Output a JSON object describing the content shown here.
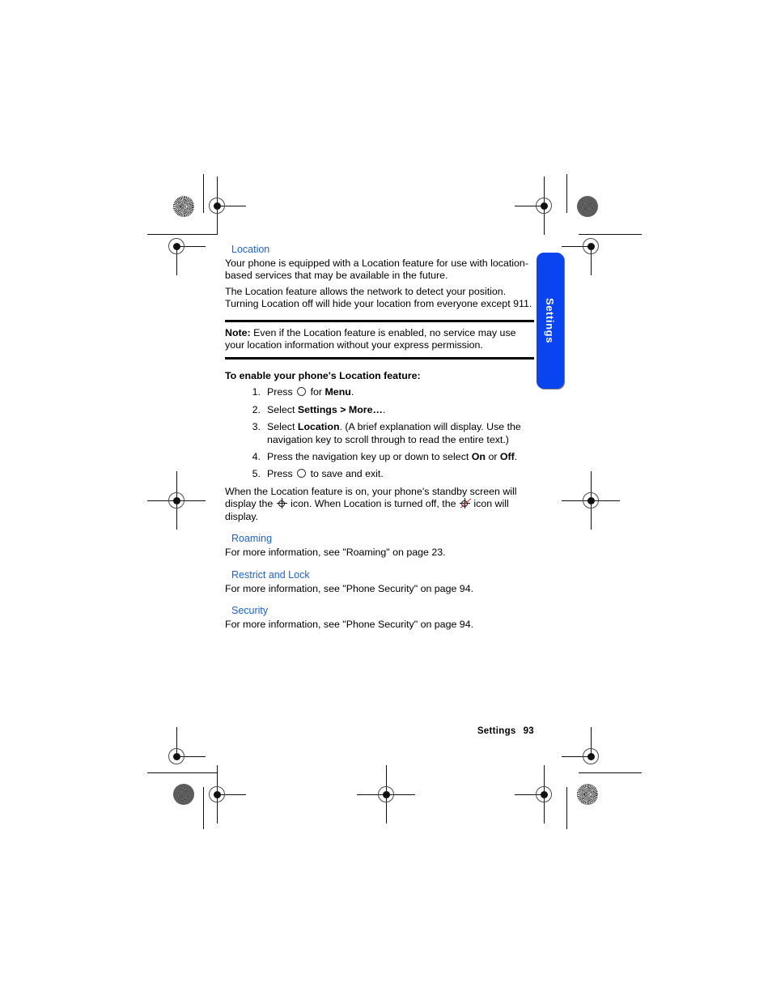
{
  "document": {
    "side_tab_label": "Settings",
    "footer": {
      "section": "Settings",
      "page_number": "93"
    }
  },
  "sections": [
    {
      "id": "location",
      "heading": "Location",
      "paragraphs": [
        "Your phone is equipped with a Location feature for use with location-based services that may be available in the future.",
        "The Location feature allows the network to detect your position. Turning Location off will hide your location from everyone except 911."
      ]
    }
  ],
  "note": {
    "label": "Note:",
    "text": " Even if the Location feature is enabled, no service may use your location information without your express permission."
  },
  "procedure": {
    "heading": "To enable your phone's Location feature:",
    "steps": [
      {
        "number": "1.",
        "before": "Press ",
        "icon": "ok-key-circle-icon",
        "after_plain": " for ",
        "after_bold": "Menu",
        "tail": "."
      },
      {
        "number": "2.",
        "before": "Select ",
        "after_bold": "Settings > More…",
        "tail": "."
      },
      {
        "number": "3.",
        "before": "Select ",
        "after_bold": "Location",
        "tail": ". (A brief explanation will display. Use the navigation key to scroll through to read the entire text.)"
      },
      {
        "number": "4.",
        "before": "Press the navigation key up or down to select ",
        "after_bold": "On",
        "mid": " or ",
        "after_bold2": "Off",
        "tail": "."
      },
      {
        "number": "5.",
        "before": "Press ",
        "icon": "ok-key-circle-icon",
        "after_plain": " to save and exit.",
        "tail": ""
      }
    ]
  },
  "closing": {
    "part1": "When the Location feature is on, your phone's standby screen will display the ",
    "icon_on": "location-on-icon",
    "part2": " icon. When Location is turned off, the ",
    "icon_off": "location-off-icon",
    "part3": " icon will display."
  },
  "cross_references": [
    {
      "heading": "Roaming",
      "text": "For more information, see \"Roaming\" on page 23."
    },
    {
      "heading": "Restrict and Lock",
      "text": "For more information, see \"Phone Security\" on page 94."
    },
    {
      "heading": "Security",
      "text": "For more information, see \"Phone Security\" on page 94."
    }
  ],
  "colors": {
    "heading_blue": "#1b63d6",
    "tab_blue": "#0a43f0",
    "slash_red": "#e02020"
  }
}
